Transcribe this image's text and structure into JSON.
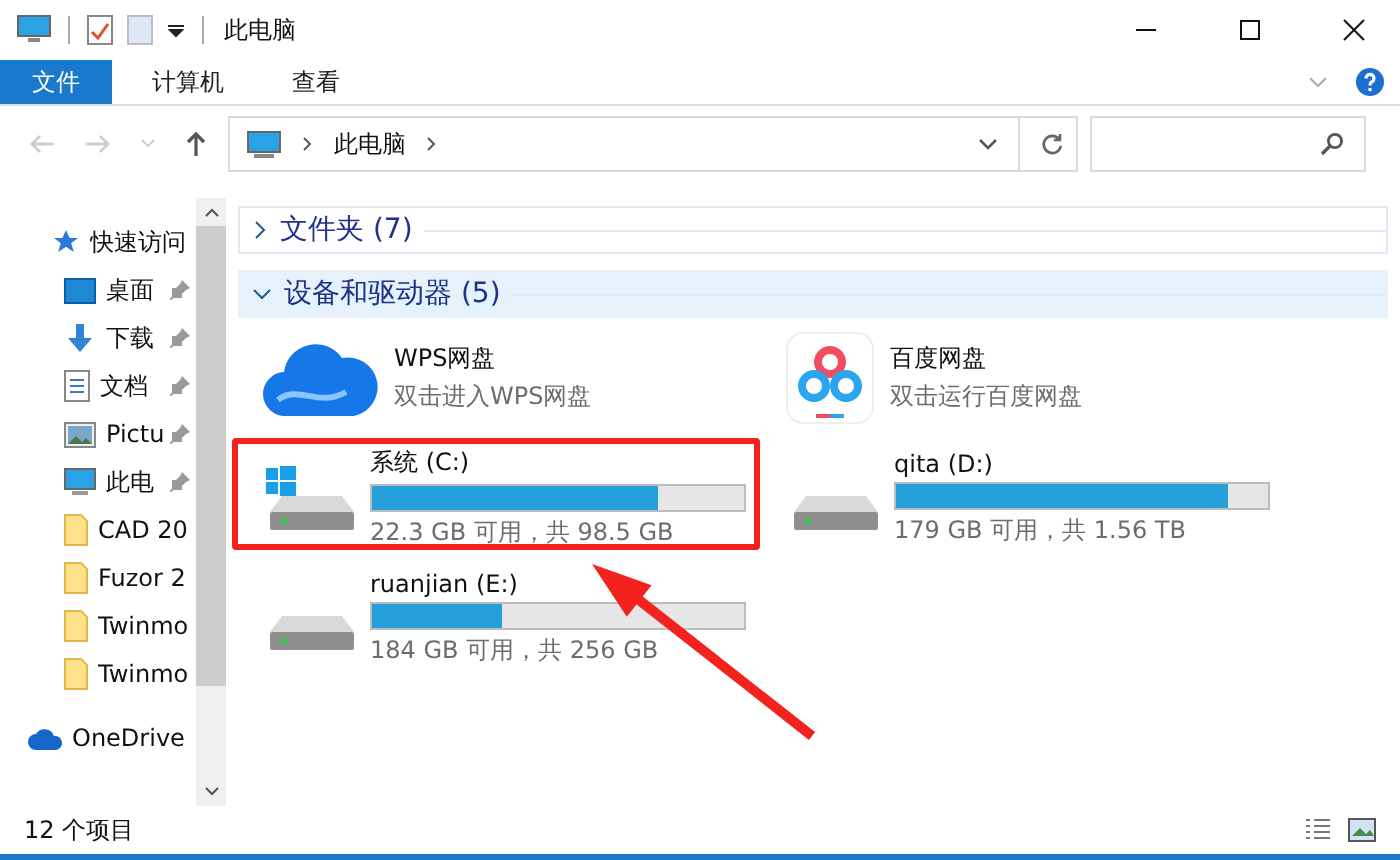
{
  "window": {
    "title": "此电脑"
  },
  "ribbon_tabs": [
    {
      "label": "文件",
      "selected": true
    },
    {
      "label": "计算机",
      "selected": false
    },
    {
      "label": "查看",
      "selected": false
    }
  ],
  "address": {
    "path": "此电脑"
  },
  "sidebar": {
    "items": [
      {
        "label": "快速访问",
        "kind": "star",
        "pinned": false
      },
      {
        "label": "桌面",
        "kind": "desktop",
        "pinned": true
      },
      {
        "label": "下载",
        "kind": "download",
        "pinned": true
      },
      {
        "label": "文档",
        "kind": "document",
        "pinned": true
      },
      {
        "label": "Pictu",
        "kind": "pictures",
        "pinned": true
      },
      {
        "label": "此电",
        "kind": "computer",
        "pinned": true
      },
      {
        "label": "CAD 20",
        "kind": "folder",
        "pinned": false
      },
      {
        "label": "Fuzor 2",
        "kind": "folder",
        "pinned": false
      },
      {
        "label": "Twinmo",
        "kind": "folder",
        "pinned": false
      },
      {
        "label": "Twinmo",
        "kind": "folder",
        "pinned": false
      },
      {
        "label": "OneDrive",
        "kind": "cloud",
        "pinned": false
      }
    ]
  },
  "groups": [
    {
      "title": "文件夹 (7)",
      "expanded": false
    },
    {
      "title": "设备和驱动器 (5)",
      "expanded": true
    }
  ],
  "devices": [
    {
      "kind": "app",
      "name": "WPS网盘",
      "subtitle": "双击进入WPS网盘"
    },
    {
      "kind": "app",
      "name": "百度网盘",
      "subtitle": "双击运行百度网盘"
    },
    {
      "kind": "drive",
      "system": true,
      "name": "系统 (C:)",
      "level": 0.77,
      "info": "22.3 GB 可用，共 98.5 GB"
    },
    {
      "kind": "drive",
      "system": false,
      "name": "qita (D:)",
      "level": 0.89,
      "info": "179 GB 可用，共 1.56 TB"
    },
    {
      "kind": "drive",
      "system": false,
      "name": "ruanjian (E:)",
      "level": 0.35,
      "info": "184 GB 可用，共 256 GB"
    }
  ],
  "status_bar": {
    "count": "12 个项目"
  }
}
